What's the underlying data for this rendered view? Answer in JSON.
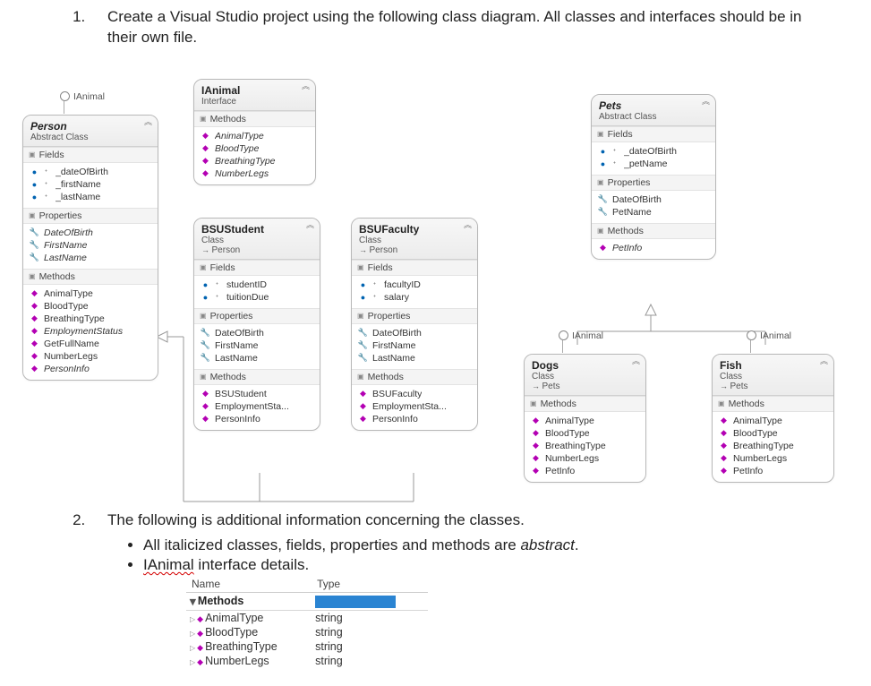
{
  "q1": "Create a Visual Studio project using the following class diagram. All classes and interfaces should be in their own file.",
  "q2": "The following is additional information concerning the classes.",
  "bullets": {
    "b1_prefix": "All italicized classes, fields, properties and methods are ",
    "b1_em": "abstract",
    "b1_suffix": ".",
    "b2_prefix": "",
    "b2_wavy": "IAnimal",
    "b2_suffix": " interface details."
  },
  "lollipop_label": "IAnimal",
  "boxes": {
    "ianimal": {
      "title": "IAnimal",
      "stereo": "Interface",
      "methods": [
        "AnimalType",
        "BloodType",
        "BreathingType",
        "NumberLegs"
      ]
    },
    "person": {
      "title": "Person",
      "stereo": "Abstract Class",
      "fields": [
        "_dateOfBirth",
        "_firstName",
        "_lastName"
      ],
      "props": [
        "DateOfBirth",
        "FirstName",
        "LastName"
      ],
      "methods": [
        "AnimalType",
        "BloodType",
        "BreathingType",
        "EmploymentStatus",
        "GetFullName",
        "NumberLegs",
        "PersonInfo"
      ]
    },
    "bsustudent": {
      "title": "BSUStudent",
      "stereo": "Class",
      "inherit": "Person",
      "fields": [
        "studentID",
        "tuitionDue"
      ],
      "props": [
        "DateOfBirth",
        "FirstName",
        "LastName"
      ],
      "methods": [
        "BSUStudent",
        "EmploymentSta...",
        "PersonInfo"
      ]
    },
    "bsufaculty": {
      "title": "BSUFaculty",
      "stereo": "Class",
      "inherit": "Person",
      "fields": [
        "facultyID",
        "salary"
      ],
      "props": [
        "DateOfBirth",
        "FirstName",
        "LastName"
      ],
      "methods": [
        "BSUFaculty",
        "EmploymentSta...",
        "PersonInfo"
      ]
    },
    "pets": {
      "title": "Pets",
      "stereo": "Abstract Class",
      "fields": [
        "_dateOfBirth",
        "_petName"
      ],
      "props": [
        "DateOfBirth",
        "PetName"
      ],
      "methods": [
        "PetInfo"
      ]
    },
    "dogs": {
      "title": "Dogs",
      "stereo": "Class",
      "inherit": "Pets",
      "methods": [
        "AnimalType",
        "BloodType",
        "BreathingType",
        "NumberLegs",
        "PetInfo"
      ]
    },
    "fish": {
      "title": "Fish",
      "stereo": "Class",
      "inherit": "Pets",
      "methods": [
        "AnimalType",
        "BloodType",
        "BreathingType",
        "NumberLegs",
        "PetInfo"
      ]
    }
  },
  "italic_map": {
    "person": {
      "title": true,
      "props": [
        "DateOfBirth",
        "FirstName",
        "LastName"
      ],
      "methods": [
        "EmploymentStatus",
        "PersonInfo"
      ]
    },
    "ianimal": {
      "methods": [
        "AnimalType",
        "BloodType",
        "BreathingType",
        "NumberLegs"
      ]
    },
    "pets": {
      "title": true,
      "methods": [
        "PetInfo"
      ]
    }
  },
  "section_labels": {
    "fields": "Fields",
    "props": "Properties",
    "methods": "Methods"
  },
  "details_table": {
    "headers": [
      "Name",
      "Type"
    ],
    "group": "Methods",
    "rows": [
      {
        "name": "AnimalType",
        "type": "string"
      },
      {
        "name": "BloodType",
        "type": "string"
      },
      {
        "name": "BreathingType",
        "type": "string"
      },
      {
        "name": "NumberLegs",
        "type": "string"
      }
    ]
  }
}
